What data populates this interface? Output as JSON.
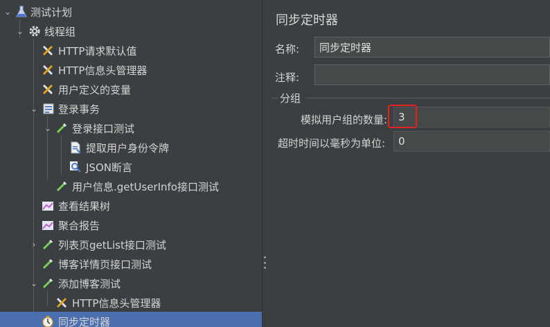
{
  "tree": {
    "items": [
      {
        "label": "测试计划",
        "icon": "flask-icon",
        "expander": "expanded"
      },
      {
        "label": "线程组",
        "icon": "gear-icon",
        "expander": "expanded"
      },
      {
        "label": "HTTP请求默认值",
        "icon": "wrench-icon",
        "expander": ""
      },
      {
        "label": "HTTP信息头管理器",
        "icon": "wrench-icon",
        "expander": ""
      },
      {
        "label": "用户定义的变量",
        "icon": "wrench-icon",
        "expander": ""
      },
      {
        "label": "登录事务",
        "icon": "transaction-controller-icon",
        "expander": "expanded"
      },
      {
        "label": "登录接口测试",
        "icon": "pipette-icon",
        "expander": "expanded"
      },
      {
        "label": "提取用户身份令牌",
        "icon": "document-icon",
        "expander": ""
      },
      {
        "label": "JSON断言",
        "icon": "magnifier-icon",
        "expander": ""
      },
      {
        "label": "用户信息.getUserInfo接口测试",
        "icon": "pipette-icon",
        "expander": ""
      },
      {
        "label": "查看结果树",
        "icon": "graph-icon",
        "expander": ""
      },
      {
        "label": "聚合报告",
        "icon": "graph-icon",
        "expander": ""
      },
      {
        "label": "列表页getList接口测试",
        "icon": "pipette-icon",
        "expander": "collapsed"
      },
      {
        "label": "博客详情页接口测试",
        "icon": "pipette-icon",
        "expander": ""
      },
      {
        "label": "添加博客测试",
        "icon": "pipette-icon",
        "expander": "expanded"
      },
      {
        "label": "HTTP信息头管理器",
        "icon": "wrench-icon",
        "expander": ""
      },
      {
        "label": "同步定时器",
        "icon": "stopwatch-icon",
        "expander": "",
        "selected": true
      }
    ]
  },
  "panel": {
    "title": "同步定时器",
    "name_label": "名称:",
    "name_value": "同步定时器",
    "comment_label": "注释:",
    "comment_value": "",
    "group_title": "分组",
    "users_label": "模拟用户组的数量:",
    "users_value": "3",
    "timeout_label": "超时时间以毫秒为单位:",
    "timeout_value": "0"
  },
  "colors": {
    "background": "#3c3f41",
    "selection": "#4b6eaf",
    "highlight_box": "#e8201e"
  }
}
